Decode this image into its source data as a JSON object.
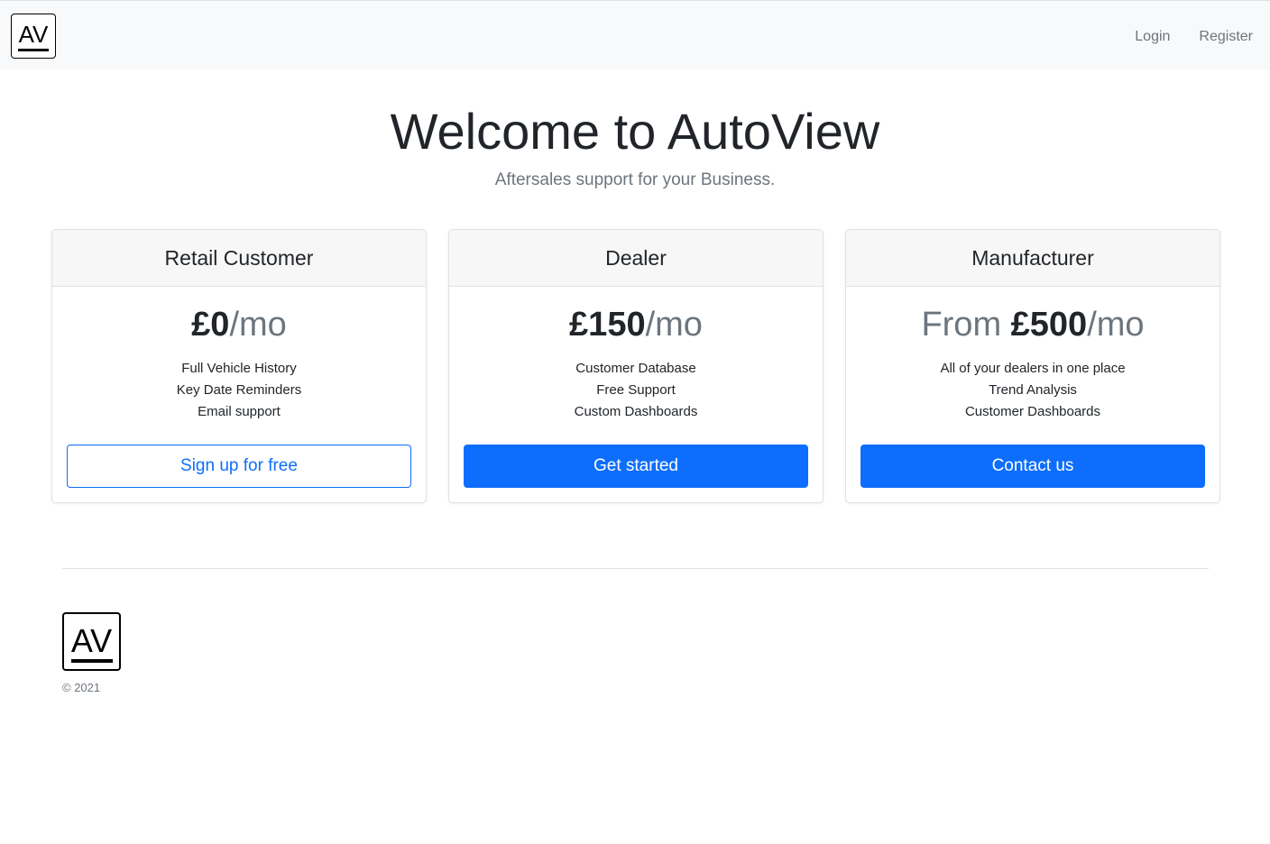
{
  "nav": {
    "logo_text": "AV",
    "links": [
      "Login",
      "Register"
    ]
  },
  "hero": {
    "title": "Welcome to AutoView",
    "subtitle": "Aftersales support for your Business."
  },
  "plans": [
    {
      "name": "Retail Customer",
      "prefix": "",
      "price": "£0",
      "period": "/mo",
      "features": [
        "Full Vehicle History",
        "Key Date Reminders",
        "Email support"
      ],
      "button": "Sign up for free",
      "button_style": "outline"
    },
    {
      "name": "Dealer",
      "prefix": "",
      "price": "£150",
      "period": "/mo",
      "features": [
        "Customer Database",
        "Free Support",
        "Custom Dashboards"
      ],
      "button": "Get started",
      "button_style": "primary"
    },
    {
      "name": "Manufacturer",
      "prefix": "From ",
      "price": "£500",
      "period": "/mo",
      "features": [
        "All of your dealers in one place",
        "Trend Analysis",
        "Customer Dashboards"
      ],
      "button": "Contact us",
      "button_style": "primary"
    }
  ],
  "footer": {
    "logo_text": "AV",
    "copyright": "© 2021"
  },
  "colors": {
    "primary": "#0d6efd",
    "muted": "#6c757d",
    "navbar_bg": "#f8f9fa",
    "card_header_bg": "#f7f7f7"
  }
}
